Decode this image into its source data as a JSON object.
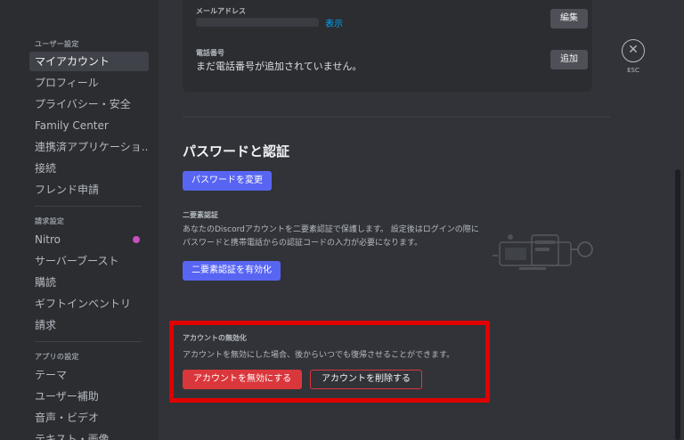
{
  "sidebar": {
    "user_settings_heading": "ユーザー設定",
    "user_items": [
      "マイアカウント",
      "プロフィール",
      "プライバシー・安全",
      "Family Center",
      "連携済アプリケーショ...",
      "接続",
      "フレンド申請"
    ],
    "billing_heading": "請求設定",
    "billing_items": [
      "Nitro",
      "サーバーブースト",
      "購読",
      "ギフトインベントリ",
      "請求"
    ],
    "app_heading": "アプリの設定",
    "app_items": [
      "テーマ",
      "ユーザー補助",
      "音声・ビデオ",
      "テキスト・画像"
    ]
  },
  "account_card": {
    "email_label": "メールアドレス",
    "email_show": "表示",
    "email_edit": "編集",
    "phone_label": "電話番号",
    "phone_value": "まだ電話番号が追加されていません。",
    "phone_add": "追加"
  },
  "close": {
    "icon": "close-icon",
    "label": "ESC"
  },
  "password_section": {
    "title": "パスワードと認証",
    "change_password": "パスワードを変更",
    "tfa_label": "二要素認証",
    "tfa_desc": "あなたのDiscordアカウントを二要素認証で保護します。 設定後はログインの際にパスワードと携帯電話からの認証コードの入力が必要になります。",
    "tfa_enable": "二要素認証を有効化"
  },
  "deactivation": {
    "label": "アカウントの無効化",
    "desc": "アカウントを無効にした場合、後からいつでも復帰させることができます。",
    "disable_btn": "アカウントを無効にする",
    "delete_btn": "アカウントを削除する"
  },
  "colors": {
    "highlight": "#e00000",
    "blurple": "#5865f2",
    "danger": "#da373c"
  }
}
